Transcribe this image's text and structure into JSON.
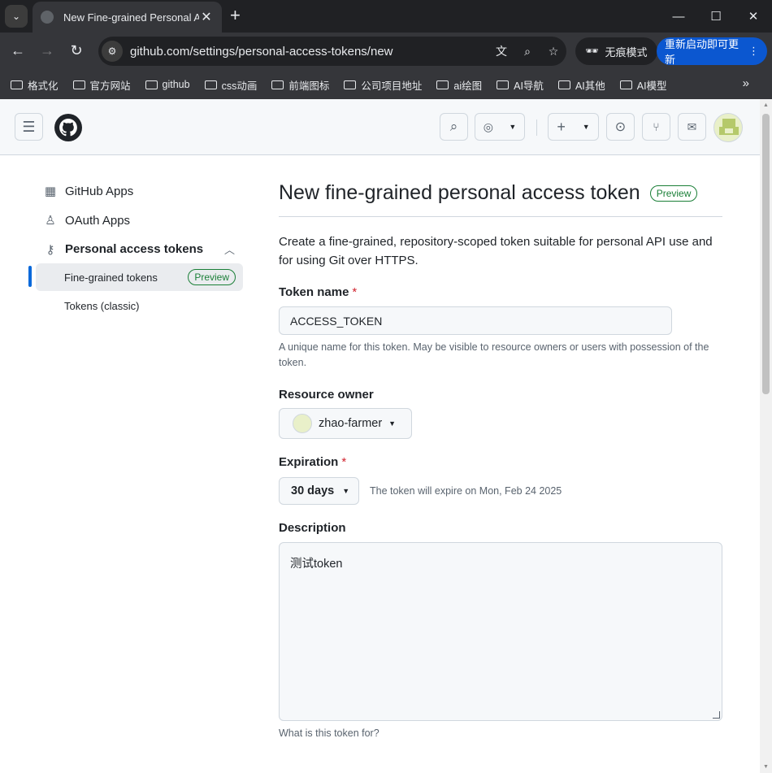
{
  "browser": {
    "tab_title": "New Fine-grained Personal Access Token",
    "url": "github.com/settings/personal-access-tokens/new",
    "incognito_label": "无痕模式",
    "relaunch_label": "重新启动即可更新",
    "bookmarks": [
      "格式化",
      "官方网站",
      "github",
      "css动画",
      "前端图标",
      "公司项目地址",
      "ai绘图",
      "AI导航",
      "AI其他",
      "AI模型"
    ]
  },
  "sidebar": {
    "items": [
      {
        "label": "GitHub Apps",
        "icon": "apps-icon"
      },
      {
        "label": "OAuth Apps",
        "icon": "person-icon"
      },
      {
        "label": "Personal access tokens",
        "icon": "key-icon"
      }
    ],
    "sub_items": [
      {
        "label": "Fine-grained tokens",
        "badge": "Preview",
        "active": true
      },
      {
        "label": "Tokens (classic)"
      }
    ]
  },
  "main": {
    "title": "New fine-grained personal access token",
    "title_badge": "Preview",
    "intro": "Create a fine-grained, repository-scoped token suitable for personal API use and for using Git over HTTPS.",
    "token_name": {
      "label": "Token name",
      "required_mark": "*",
      "value": "ACCESS_TOKEN",
      "hint": "A unique name for this token. May be visible to resource owners or users with possession of the token."
    },
    "resource_owner": {
      "label": "Resource owner",
      "value": "zhao-farmer"
    },
    "expiration": {
      "label": "Expiration",
      "required_mark": "*",
      "value": "30 days",
      "note": "The token will expire on Mon, Feb 24 2025"
    },
    "description": {
      "label": "Description",
      "value": "测试token",
      "hint": "What is this token for?"
    }
  },
  "colors": {
    "accent": "#0969da",
    "success": "#1a7f37",
    "danger": "#d1242f",
    "chrome_dark": "#202124",
    "chrome_toolbar": "#35363a",
    "relaunch_blue": "#0b57d0"
  }
}
